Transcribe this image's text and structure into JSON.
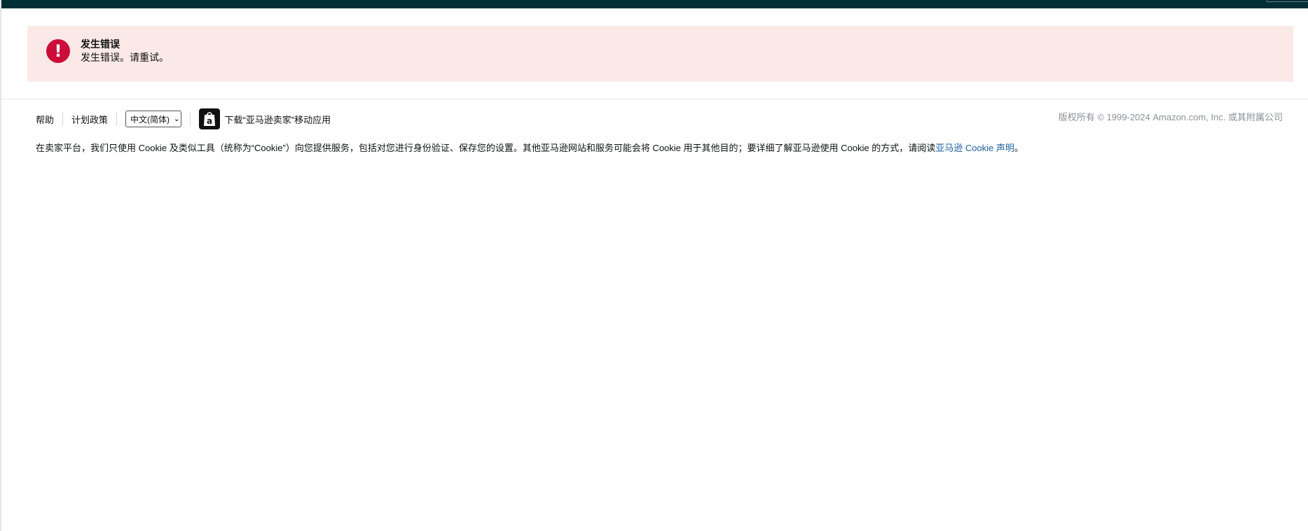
{
  "error_alert": {
    "title": "发生错误",
    "message": "发生错误。请重试。",
    "icon": "exclamation-icon",
    "background_color": "#fbe9e8",
    "icon_color": "#cc0c39"
  },
  "header": {
    "bar_color": "#002f36"
  },
  "footer": {
    "help_label": "帮助",
    "policy_label": "计划政策",
    "language_selected": "中文(简体)",
    "app_download_label": "下载“亚马逊卖家”移动应用",
    "app_icon": "amazon-seller-app-icon",
    "copyright": "版权所有 © 1999-2024 Amazon.com, Inc. 或其附属公司"
  },
  "cookie_notice": {
    "text": "在卖家平台，我们只使用 Cookie 及类似工具（统称为“Cookie”）向您提供服务，包括对您进行身份验证、保存您的设置。其他亚马逊网站和服务可能会将 Cookie 用于其他目的；要详细了解亚马逊使用 Cookie 的方式，请阅读",
    "link_text": "亚马逊 Cookie 声明",
    "suffix": "。",
    "link_color": "#2162a1"
  }
}
